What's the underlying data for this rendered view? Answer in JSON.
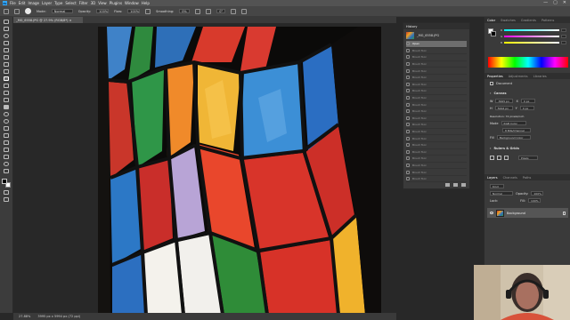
{
  "colors": {
    "accent": "#31a8ff",
    "ui_dark": "#282828",
    "panel": "#3a3a3a",
    "menubar": "#535353"
  },
  "menubar": {
    "logo": "Ps",
    "items": [
      "File",
      "Edit",
      "Image",
      "Layer",
      "Type",
      "Select",
      "Filter",
      "3D",
      "View",
      "Plugins",
      "Window",
      "Help"
    ],
    "window_controls": [
      "—",
      "▢",
      "✕"
    ]
  },
  "options": {
    "mode_label": "Mode:",
    "mode_value": "Normal",
    "opacity_label": "Opacity:",
    "opacity_value": "100%",
    "flow_label": "Flow:",
    "flow_value": "100%",
    "smoothing_label": "Smoothing:",
    "smoothing_value": "0%",
    "angle_value": "0°"
  },
  "document": {
    "tab_title": "_MG_6558.JPG @ 27.9% (RGB/8*) ×"
  },
  "status": {
    "zoom": "27.88%",
    "doc_size": "3995 px x 5994 px (72 ppi)"
  },
  "history": {
    "tab_label": "History",
    "snapshot_name": "_MG_6558.JPG",
    "items": [
      "Open",
      "Brush Tool",
      "Brush Tool",
      "Brush Tool",
      "Brush Tool",
      "Brush Tool",
      "Brush Tool",
      "Brush Tool",
      "Brush Tool",
      "Brush Tool",
      "Brush Tool",
      "Brush Tool",
      "Brush Tool",
      "Brush Tool",
      "Brush Tool",
      "Brush Tool",
      "Brush Tool",
      "Brush Tool",
      "Brush Tool",
      "Brush Tool",
      "Brush Tool"
    ]
  },
  "color_panel": {
    "tabs": [
      "Color",
      "Swatches",
      "Gradients",
      "Patterns"
    ],
    "sliders": [
      "R",
      "G",
      "B"
    ]
  },
  "properties_panel": {
    "tabs": [
      "Properties",
      "Adjustments",
      "Libraries"
    ],
    "doc_label": "Document",
    "canvas_title": "Canvas",
    "width_label": "W",
    "width_value": "3995 px",
    "height_label": "H",
    "height_value": "5994 px",
    "x_label": "X",
    "x_value": "0 px",
    "y_label": "Y",
    "y_value": "0 px",
    "resolution": "Resolution: 72 pixels/inch",
    "mode_label": "Mode",
    "mode_value": "RGB Color",
    "depth_value": "8 Bits/Channel",
    "fill_label": "Fill",
    "fill_value": "Background Color",
    "rulers_title": "Rulers & Grids",
    "unit_value": "Pixels"
  },
  "layers_panel": {
    "tabs": [
      "Layers",
      "Channels",
      "Paths"
    ],
    "kind_label": "Kind",
    "blend_value": "Normal",
    "opacity_label": "Opacity:",
    "opacity_value": "100%",
    "lock_label": "Lock:",
    "fill_label": "Fill:",
    "fill_value": "100%",
    "layer_name": "Background"
  }
}
